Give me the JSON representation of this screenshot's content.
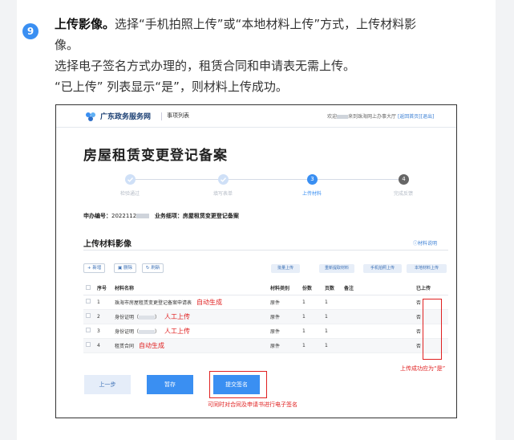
{
  "instruction": {
    "step_number": "9",
    "heading": "上传影像。",
    "line1": "选择“手机拍照上传”或“本地材料上传”方式，上传材料影",
    "line1b": "像。",
    "line2": "选择电子签名方式办理的，租赁合同和申请表无需上传。",
    "line3": "“已上传” 列表显示“是”，则材料上传成功。"
  },
  "portal": {
    "brand": "广东政务服务网",
    "nav_item": "事项列表",
    "welcome_prefix": "欢迎",
    "welcome_suffix": "来到珠海网上办事大厅",
    "welcome_link": "[返回首页][退出]"
  },
  "page_title": "房屋租赁变更登记备案",
  "steps": [
    {
      "num": "✓",
      "label": "检验通过",
      "state": "done"
    },
    {
      "num": "✓",
      "label": "填写表单",
      "state": "done"
    },
    {
      "num": "3",
      "label": "上传材料",
      "state": "active"
    },
    {
      "num": "4",
      "label": "完成反馈",
      "state": "pending"
    }
  ],
  "request": {
    "no_label": "申办编号：",
    "no_value": "2022112",
    "item_label": "业务细项：",
    "item_value": "房屋租赁变更登记备案"
  },
  "section": {
    "title": "上传材料影像",
    "help": "材料说明"
  },
  "toolbar": {
    "add": "+ 新增",
    "delete": "删除",
    "refresh": "刷新"
  },
  "upload_buttons": [
    "批量上传",
    "重新提取材料",
    "手机拍照上传",
    "本地材料上传"
  ],
  "table": {
    "headers": [
      "序号",
      "材料名称",
      "材料类别",
      "份数",
      "页数",
      "备注",
      "已上传"
    ],
    "rows": [
      {
        "no": "1",
        "name": "珠海市房屋租赁变更登记备案申请表",
        "category": "原件",
        "copies": "1",
        "pages": "1",
        "note": "",
        "uploaded": "否",
        "annotation": "自动生成"
      },
      {
        "no": "2",
        "name": "身份证明（",
        "category": "原件",
        "copies": "1",
        "pages": "1",
        "note": "",
        "uploaded": "否",
        "annotation": "人工上传"
      },
      {
        "no": "3",
        "name": "身份证明（",
        "category": "原件",
        "copies": "1",
        "pages": "1",
        "note": "",
        "uploaded": "否",
        "annotation": "人工上传"
      },
      {
        "no": "4",
        "name": "租赁合同",
        "category": "原件",
        "copies": "1",
        "pages": "1",
        "note": "",
        "uploaded": "否",
        "annotation": "自动生成"
      }
    ]
  },
  "annotations": {
    "upload_success": "上传成功应为“是”",
    "sign_note": "可同时对合同及申请书进行电子签名"
  },
  "buttons": {
    "prev": "上一步",
    "save": "暂存",
    "submit": "提交签名"
  },
  "colors": {
    "accent": "#3a8ff2",
    "annotation_red": "#e02020"
  }
}
